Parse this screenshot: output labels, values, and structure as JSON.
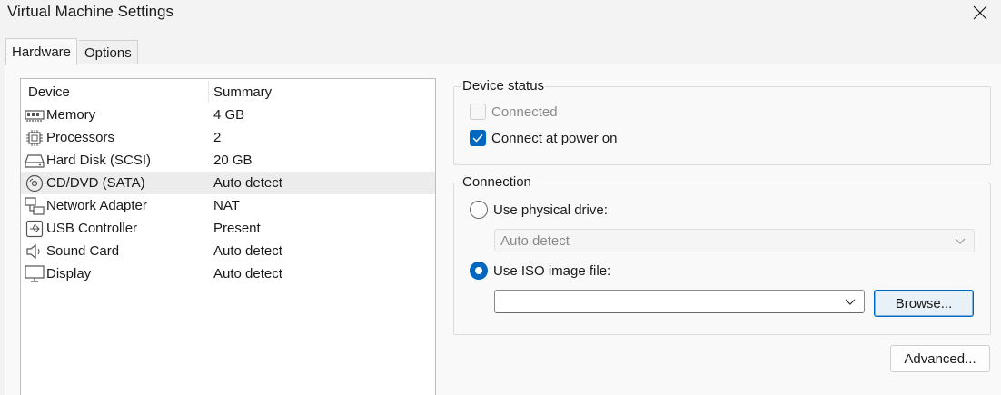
{
  "window": {
    "title": "Virtual Machine Settings",
    "close_icon": "close-icon"
  },
  "tabs": [
    {
      "label": "Hardware",
      "active": true
    },
    {
      "label": "Options",
      "active": false
    }
  ],
  "device_list": {
    "headers": {
      "device": "Device",
      "summary": "Summary"
    },
    "rows": [
      {
        "icon": "memory-icon",
        "device": "Memory",
        "summary": "4 GB",
        "selected": false
      },
      {
        "icon": "processor-icon",
        "device": "Processors",
        "summary": "2",
        "selected": false
      },
      {
        "icon": "hard-disk-icon",
        "device": "Hard Disk (SCSI)",
        "summary": "20 GB",
        "selected": false
      },
      {
        "icon": "cd-dvd-icon",
        "device": "CD/DVD (SATA)",
        "summary": "Auto detect",
        "selected": true
      },
      {
        "icon": "network-adapter-icon",
        "device": "Network Adapter",
        "summary": "NAT",
        "selected": false
      },
      {
        "icon": "usb-icon",
        "device": "USB Controller",
        "summary": "Present",
        "selected": false
      },
      {
        "icon": "sound-card-icon",
        "device": "Sound Card",
        "summary": "Auto detect",
        "selected": false
      },
      {
        "icon": "display-icon",
        "device": "Display",
        "summary": "Auto detect",
        "selected": false
      }
    ]
  },
  "device_status": {
    "title": "Device status",
    "connected": {
      "label": "Connected",
      "checked": false,
      "enabled": false
    },
    "connect_at_power_on": {
      "label": "Connect at power on",
      "checked": true,
      "enabled": true
    }
  },
  "connection": {
    "title": "Connection",
    "use_physical_drive": {
      "label": "Use physical drive:",
      "selected": false
    },
    "physical_drive_select": {
      "value": "Auto detect",
      "enabled": false
    },
    "use_iso_image": {
      "label": "Use ISO image file:",
      "selected": true
    },
    "iso_path": {
      "value": ""
    },
    "browse_label": "Browse..."
  },
  "advanced_label": "Advanced...",
  "colors": {
    "accent": "#0067c0",
    "selection": "#ececec"
  }
}
